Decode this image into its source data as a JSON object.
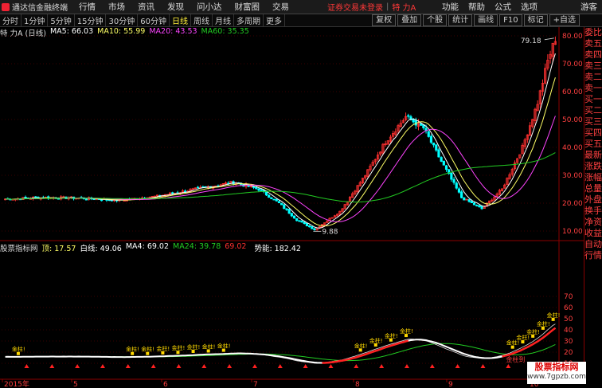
{
  "app": {
    "logo_text": "通达信金融终端"
  },
  "menu": [
    "行情",
    "市场",
    "资讯",
    "发现",
    "问小达",
    "财富圈",
    "交易"
  ],
  "login_text": "证券交易未登录",
  "stock_name_top": "特 力A",
  "right_menu": [
    "功能",
    "帮助",
    "公式",
    "选项",
    "游客"
  ],
  "periods": [
    "分时",
    "1分钟",
    "5分钟",
    "15分钟",
    "30分钟",
    "60分钟",
    "日线",
    "周线",
    "月线",
    "多周期",
    "更多"
  ],
  "active_period": "日线",
  "tools": [
    "复权",
    "叠加",
    "个股",
    "统计",
    "画线",
    "F10",
    "标记",
    "+自选"
  ],
  "ma_legend": {
    "title": "特 力A (日线)",
    "ma5": "MA5: 66.03",
    "ma10": "MA10: 55.99",
    "ma20": "MA20: 43.53",
    "ma60": "MA60: 35.35"
  },
  "price_axis": {
    "ticks": [
      80,
      70,
      60,
      50,
      40,
      30,
      20,
      10
    ],
    "labels": [
      "80.00",
      "70.00",
      "60.00",
      "50.00",
      "40.00",
      "30.00",
      "20.00",
      "10.00"
    ]
  },
  "annotations": {
    "high": "79.18",
    "low": "9.88"
  },
  "ind_legend": {
    "name": "股票指标网",
    "v1": "顶: 17.57",
    "v2": "白线: 49.06",
    "v3": "MA4: 69.02",
    "v4": "MA24: 39.78",
    "v5": "69.02",
    "v6": "",
    "v7": "势能: 182.42"
  },
  "ind_axis": {
    "ticks": [
      70,
      60,
      50,
      40,
      30,
      20,
      10
    ],
    "labels": [
      "70",
      "60",
      "50",
      "40",
      "30",
      "20",
      "10"
    ]
  },
  "ind_marks": {
    "gold": "金柱!",
    "signal": "金柱到"
  },
  "date_axis": {
    "labels": [
      "2015年",
      "5",
      "6",
      "7",
      "8",
      "9",
      "10"
    ]
  },
  "sidebar": [
    "委比",
    "卖五",
    "卖四",
    "卖三",
    "卖二",
    "卖一",
    "买一",
    "买二",
    "买三",
    "买四",
    "买五",
    "最新",
    "涨跌",
    "涨幅",
    "总量",
    "外盘",
    "换手",
    "净资",
    "收益",
    "",
    "自动",
    "行情"
  ],
  "watermark": {
    "title": "股票指标网",
    "url": "www.7gpzb.com"
  },
  "colors": {
    "up": "#ff3030",
    "down": "#00ffff",
    "ma5": "#ffffff",
    "ma10": "#ffff66",
    "ma20": "#ff44ff",
    "ma60": "#22cc22",
    "accent": "#ff3838"
  }
}
